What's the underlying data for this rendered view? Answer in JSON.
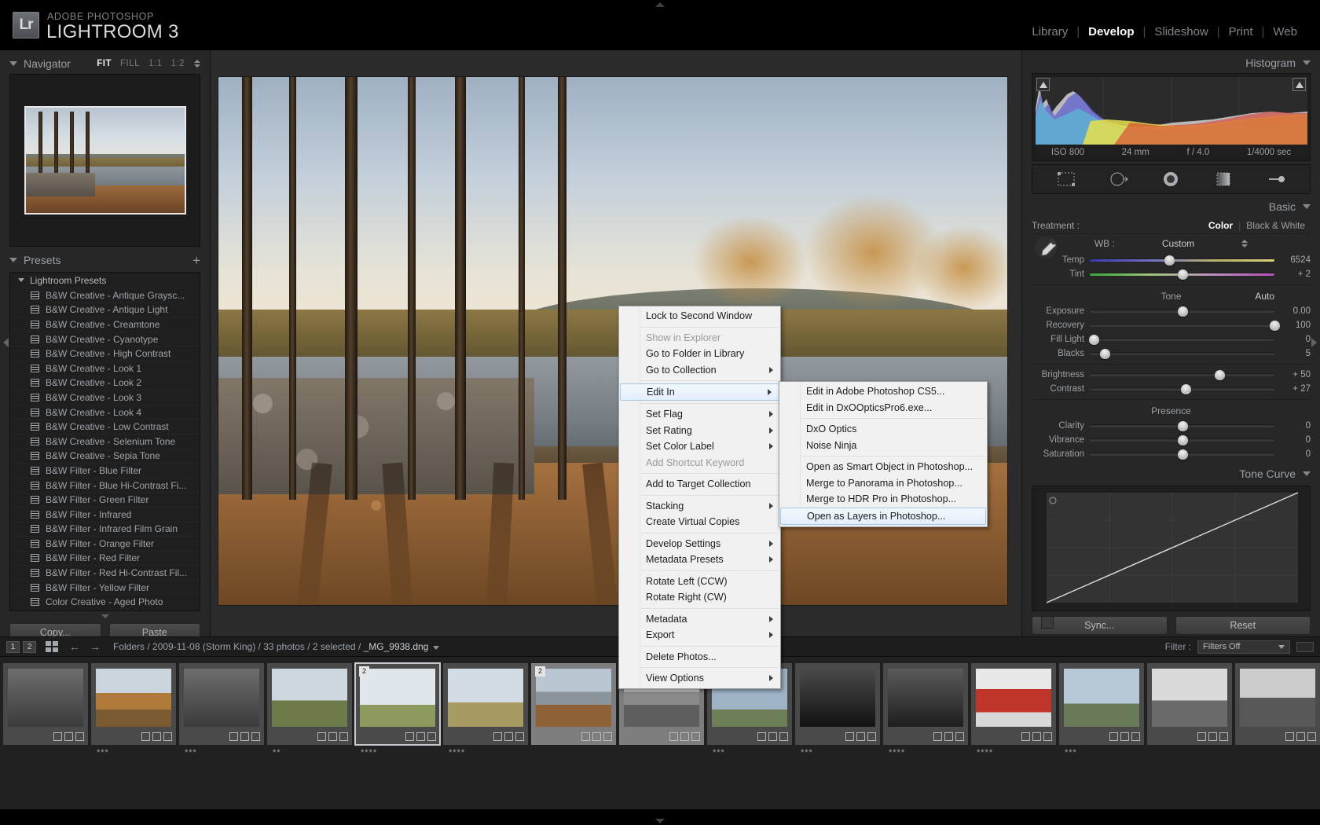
{
  "app": {
    "brand_sub": "ADOBE PHOTOSHOP",
    "brand_main": "LIGHTROOM 3",
    "logo": "Lr"
  },
  "modules": [
    {
      "label": "Library",
      "active": false
    },
    {
      "label": "Develop",
      "active": true
    },
    {
      "label": "Slideshow",
      "active": false
    },
    {
      "label": "Print",
      "active": false
    },
    {
      "label": "Web",
      "active": false
    }
  ],
  "navigator": {
    "title": "Navigator",
    "zoom_levels": [
      {
        "label": "FIT",
        "active": true
      },
      {
        "label": "FILL",
        "active": false
      },
      {
        "label": "1:1",
        "active": false
      },
      {
        "label": "1:2",
        "active": false
      }
    ]
  },
  "presets": {
    "title": "Presets",
    "add_icon": "plus-icon",
    "group": "Lightroom Presets",
    "items": [
      "B&W Creative - Antique Graysc...",
      "B&W Creative - Antique Light",
      "B&W Creative - Creamtone",
      "B&W Creative - Cyanotype",
      "B&W Creative - High Contrast",
      "B&W Creative - Look 1",
      "B&W Creative - Look 2",
      "B&W Creative - Look 3",
      "B&W Creative - Look 4",
      "B&W Creative - Low Contrast",
      "B&W Creative - Selenium Tone",
      "B&W Creative - Sepia Tone",
      "B&W Filter - Blue Filter",
      "B&W Filter - Blue Hi-Contrast Fi...",
      "B&W Filter - Green Filter",
      "B&W Filter - Infrared",
      "B&W Filter - Infrared Film Grain",
      "B&W Filter - Orange Filter",
      "B&W Filter - Red Filter",
      "B&W Filter - Red Hi-Contrast Fil...",
      "B&W Filter - Yellow Filter",
      "Color Creative - Aged Photo"
    ],
    "copy_label": "Copy...",
    "paste_label": "Paste"
  },
  "histogram": {
    "title": "Histogram",
    "iso": "ISO 800",
    "focal": "24 mm",
    "aperture": "f / 4.0",
    "shutter": "1/4000 sec"
  },
  "tools": [
    "crop-overlay-icon",
    "spot-removal-icon",
    "red-eye-icon",
    "graduated-filter-icon",
    "adjustment-brush-icon"
  ],
  "basic": {
    "title": "Basic",
    "treatment_label": "Treatment :",
    "treatment_options": [
      {
        "label": "Color",
        "active": true
      },
      {
        "label": "Black & White",
        "active": false
      }
    ],
    "wb_label": "WB :",
    "wb_value": "Custom",
    "eyedropper": "eyedropper-icon",
    "wb_sliders": [
      {
        "name": "Temp",
        "value": "6524",
        "pos": 43,
        "kind": "temp"
      },
      {
        "name": "Tint",
        "value": "+ 2",
        "pos": 50,
        "kind": "tint"
      }
    ],
    "tone_label": "Tone",
    "auto_label": "Auto",
    "tone_sliders": [
      {
        "name": "Exposure",
        "value": "0.00",
        "pos": 50
      },
      {
        "name": "Recovery",
        "value": "100",
        "pos": 100
      },
      {
        "name": "Fill Light",
        "value": "0",
        "pos": 2
      },
      {
        "name": "Blacks",
        "value": "5",
        "pos": 8
      }
    ],
    "brightness_sliders": [
      {
        "name": "Brightness",
        "value": "+ 50",
        "pos": 70
      },
      {
        "name": "Contrast",
        "value": "+ 27",
        "pos": 52
      }
    ],
    "presence_label": "Presence",
    "presence_sliders": [
      {
        "name": "Clarity",
        "value": "0",
        "pos": 50
      },
      {
        "name": "Vibrance",
        "value": "0",
        "pos": 50
      },
      {
        "name": "Saturation",
        "value": "0",
        "pos": 50
      }
    ]
  },
  "tonecurve": {
    "title": "Tone Curve"
  },
  "sync": {
    "sync_label": "Sync...",
    "reset_label": "Reset"
  },
  "filmbar": {
    "view_1": "1",
    "view_2": "2",
    "grid_icon": "grid-view-icon",
    "back_icon": "back-arrow-icon",
    "forward_icon": "forward-arrow-icon",
    "path": "Folders / 2009-11-08 (Storm King) / 33 photos / 2 selected / ",
    "selected_file": "_MG_9938.dng",
    "filter_label": "Filter :",
    "filter_value": "Filters Off"
  },
  "filmstrip": [
    {
      "stars": "",
      "num": "",
      "selected": false,
      "active": false,
      "kind": "sculpture"
    },
    {
      "stars": "***",
      "num": "",
      "selected": false,
      "active": false,
      "kind": "autumn"
    },
    {
      "stars": "***",
      "num": "",
      "selected": false,
      "active": false,
      "kind": "sculpture"
    },
    {
      "stars": "**",
      "num": "",
      "selected": false,
      "active": false,
      "kind": "dog"
    },
    {
      "stars": "****",
      "num": "2",
      "selected": false,
      "active": true,
      "kind": "lonetree"
    },
    {
      "stars": "****",
      "num": "",
      "selected": false,
      "active": false,
      "kind": "field"
    },
    {
      "stars": "",
      "num": "2",
      "selected": true,
      "active": false,
      "kind": "pond"
    },
    {
      "stars": "",
      "num": "",
      "selected": true,
      "active": false,
      "kind": "pondbw"
    },
    {
      "stars": "***",
      "num": "",
      "selected": false,
      "active": false,
      "kind": "tower"
    },
    {
      "stars": "***",
      "num": "",
      "selected": false,
      "active": false,
      "kind": "metal"
    },
    {
      "stars": "****",
      "num": "",
      "selected": false,
      "active": false,
      "kind": "pipes"
    },
    {
      "stars": "****",
      "num": "",
      "selected": false,
      "active": false,
      "kind": "redcurve"
    },
    {
      "stars": "***",
      "num": "",
      "selected": false,
      "active": false,
      "kind": "arch"
    },
    {
      "stars": "",
      "num": "",
      "selected": false,
      "active": false,
      "kind": "bwsculpt"
    },
    {
      "stars": "",
      "num": "",
      "selected": false,
      "active": false,
      "kind": "bwsculpt2"
    }
  ],
  "context_menu": {
    "items": [
      {
        "label": "Lock to Second Window",
        "disabled": false,
        "submenu": false,
        "highlighted": false,
        "sep_after": true
      },
      {
        "label": "Show in Explorer",
        "disabled": true,
        "submenu": false,
        "highlighted": false,
        "sep_after": false
      },
      {
        "label": "Go to Folder in Library",
        "disabled": false,
        "submenu": false,
        "highlighted": false,
        "sep_after": false
      },
      {
        "label": "Go to Collection",
        "disabled": false,
        "submenu": true,
        "highlighted": false,
        "sep_after": true
      },
      {
        "label": "Edit In",
        "disabled": false,
        "submenu": true,
        "highlighted": true,
        "sep_after": true
      },
      {
        "label": "Set Flag",
        "disabled": false,
        "submenu": true,
        "highlighted": false,
        "sep_after": false
      },
      {
        "label": "Set Rating",
        "disabled": false,
        "submenu": true,
        "highlighted": false,
        "sep_after": false
      },
      {
        "label": "Set Color Label",
        "disabled": false,
        "submenu": true,
        "highlighted": false,
        "sep_after": false
      },
      {
        "label": "Add Shortcut Keyword",
        "disabled": true,
        "submenu": false,
        "highlighted": false,
        "sep_after": true
      },
      {
        "label": "Add to Target Collection",
        "disabled": false,
        "submenu": false,
        "highlighted": false,
        "sep_after": true
      },
      {
        "label": "Stacking",
        "disabled": false,
        "submenu": true,
        "highlighted": false,
        "sep_after": false
      },
      {
        "label": "Create Virtual Copies",
        "disabled": false,
        "submenu": false,
        "highlighted": false,
        "sep_after": true
      },
      {
        "label": "Develop Settings",
        "disabled": false,
        "submenu": true,
        "highlighted": false,
        "sep_after": false
      },
      {
        "label": "Metadata Presets",
        "disabled": false,
        "submenu": true,
        "highlighted": false,
        "sep_after": true
      },
      {
        "label": "Rotate Left (CCW)",
        "disabled": false,
        "submenu": false,
        "highlighted": false,
        "sep_after": false
      },
      {
        "label": "Rotate Right (CW)",
        "disabled": false,
        "submenu": false,
        "highlighted": false,
        "sep_after": true
      },
      {
        "label": "Metadata",
        "disabled": false,
        "submenu": true,
        "highlighted": false,
        "sep_after": false
      },
      {
        "label": "Export",
        "disabled": false,
        "submenu": true,
        "highlighted": false,
        "sep_after": true
      },
      {
        "label": "Delete Photos...",
        "disabled": false,
        "submenu": false,
        "highlighted": false,
        "sep_after": true
      },
      {
        "label": "View Options",
        "disabled": false,
        "submenu": true,
        "highlighted": false,
        "sep_after": false
      }
    ]
  },
  "submenu": {
    "items": [
      {
        "label": "Edit in Adobe Photoshop CS5...",
        "highlighted": false,
        "sep_after": false
      },
      {
        "label": "Edit in DxOOpticsPro6.exe...",
        "highlighted": false,
        "sep_after": true
      },
      {
        "label": "DxO Optics",
        "highlighted": false,
        "sep_after": false
      },
      {
        "label": "Noise Ninja",
        "highlighted": false,
        "sep_after": true
      },
      {
        "label": "Open as Smart Object in Photoshop...",
        "highlighted": false,
        "sep_after": false
      },
      {
        "label": "Merge to Panorama in Photoshop...",
        "highlighted": false,
        "sep_after": false
      },
      {
        "label": "Merge to HDR Pro in Photoshop...",
        "highlighted": false,
        "sep_after": false
      },
      {
        "label": "Open as Layers in Photoshop...",
        "highlighted": true,
        "sep_after": false
      }
    ]
  },
  "colors": {
    "panel_bg": "#272727",
    "center_bg": "#2b2b2b",
    "accent_text": "#ffffff",
    "menu_bg": "#f1f1f1",
    "menu_highlight": "#e3eefb"
  }
}
